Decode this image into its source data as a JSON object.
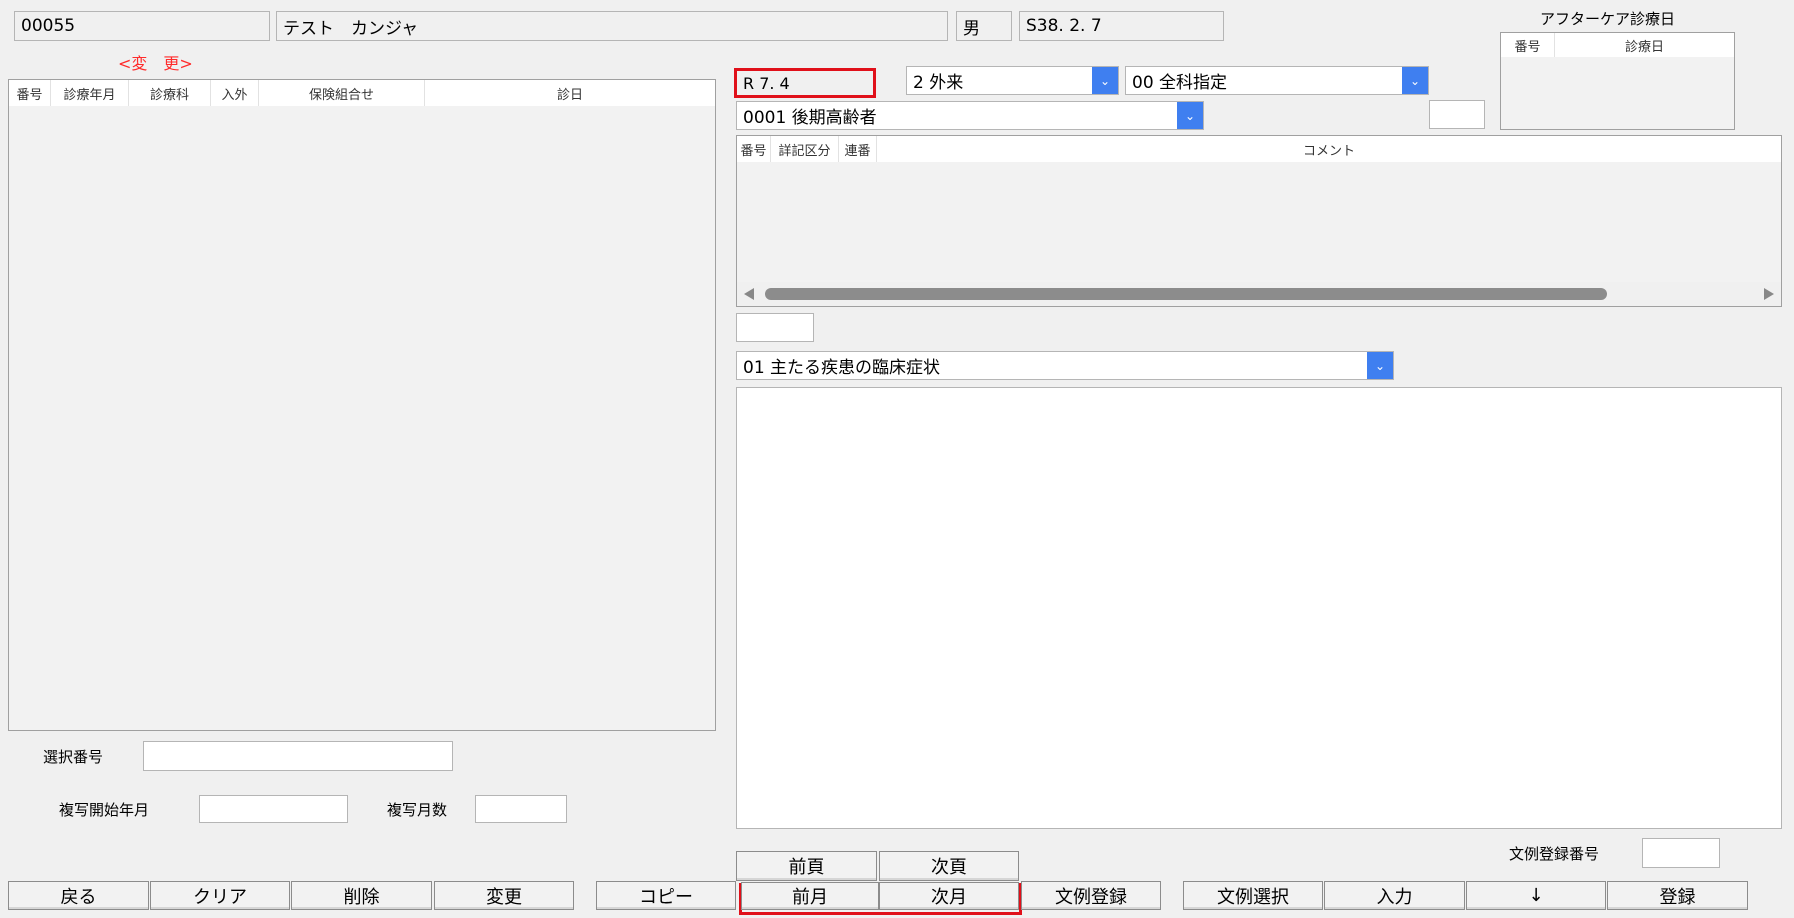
{
  "patient": {
    "id": "00055",
    "name": "テスト　カンジャ",
    "sex": "男",
    "birthdate": "S38. 2. 7"
  },
  "mode_label": "<変　更>",
  "left_table": {
    "headers": [
      "番号",
      "診療年月",
      "診療科",
      "入外",
      "保険組合せ",
      "診日"
    ]
  },
  "selection": {
    "select_number_label": "選択番号",
    "copy_start_label": "複写開始年月",
    "copy_months_label": "複写月数"
  },
  "period": {
    "value": "R 7. 4"
  },
  "visit_type_select": {
    "value": "2 外来"
  },
  "department_select": {
    "value": "00 全科指定"
  },
  "insurance_select": {
    "value": "0001 後期高齢者"
  },
  "aftercare": {
    "title": "アフターケア診療日",
    "headers": [
      "番号",
      "診療日"
    ]
  },
  "comment_table": {
    "headers": [
      "番号",
      "詳記区分",
      "連番",
      "コメント"
    ]
  },
  "detail_select": {
    "value": "01 主たる疾患の臨床症状"
  },
  "template_register_number_label": "文例登録番号",
  "buttons": {
    "back": "戻る",
    "clear": "クリア",
    "delete": "削除",
    "change": "変更",
    "copy": "コピー",
    "prev_page": "前頁",
    "next_page": "次頁",
    "prev_month": "前月",
    "next_month": "次月",
    "template_register": "文例登録",
    "template_select": "文例選択",
    "input": "入力",
    "down": "↓",
    "register": "登録"
  },
  "icons": {
    "dropdown": "chevron-down-icon",
    "scroll_left": "triangle-left-icon",
    "scroll_right": "triangle-right-icon"
  },
  "colors": {
    "accent": "#3f7ff0",
    "highlight_frame": "#e0101a",
    "mode_label": "#ff2a2a"
  }
}
